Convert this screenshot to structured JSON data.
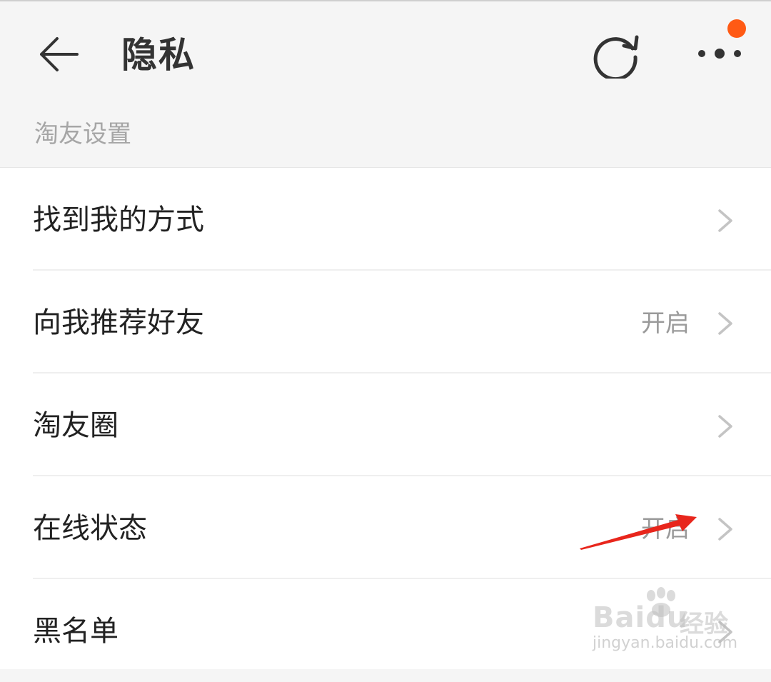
{
  "header": {
    "title": "隐私",
    "back_icon": "back-arrow-icon",
    "refresh_icon": "refresh-icon",
    "more_icon": "more-icon",
    "notification_dot_color": "#ff5a14"
  },
  "section": {
    "title": "淘友设置"
  },
  "rows": [
    {
      "label": "找到我的方式",
      "value": ""
    },
    {
      "label": "向我推荐好友",
      "value": "开启"
    },
    {
      "label": "淘友圈",
      "value": ""
    },
    {
      "label": "在线状态",
      "value": "开启"
    },
    {
      "label": "黑名单",
      "value": ""
    }
  ],
  "annotation": {
    "arrow_color": "#e8261c"
  },
  "watermark": {
    "logo_text": "Baidu",
    "cn_text": "经验",
    "url": "jingyan.baidu.com"
  }
}
